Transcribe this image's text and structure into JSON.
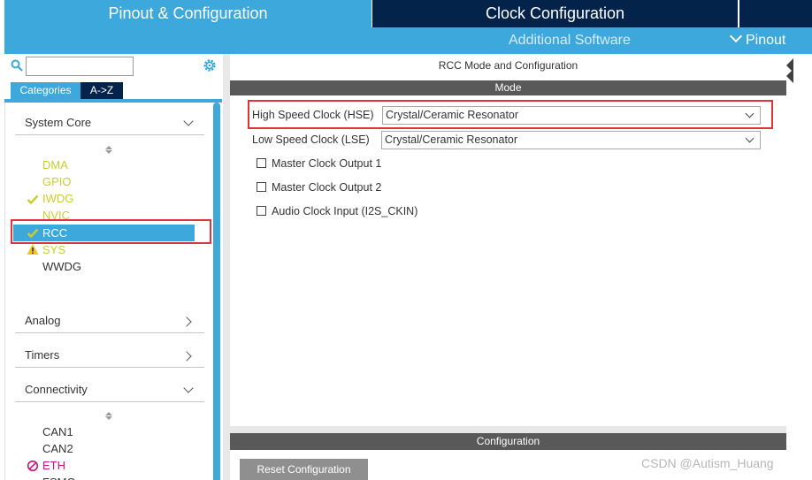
{
  "header": {
    "tabs": [
      "Pinout & Configuration",
      "Clock Configuration"
    ],
    "additional_software": "Additional Software",
    "pinout_menu": "Pinout"
  },
  "left": {
    "search": {
      "value": ""
    },
    "tabs": [
      "Categories",
      "A->Z"
    ],
    "categories": {
      "system_core": "System Core",
      "analog": "Analog",
      "timers": "Timers",
      "connectivity": "Connectivity"
    },
    "system_core_items": [
      "DMA",
      "GPIO",
      "IWDG",
      "NVIC",
      "RCC",
      "SYS",
      "WWDG"
    ],
    "connectivity_items": [
      "CAN1",
      "CAN2",
      "ETH",
      "FSMC"
    ]
  },
  "right": {
    "title": "RCC Mode and Configuration",
    "mode_header": "Mode",
    "hse": {
      "label": "High Speed Clock (HSE)",
      "value": "Crystal/Ceramic Resonator"
    },
    "lse": {
      "label": "Low Speed Clock (LSE)",
      "value": "Crystal/Ceramic Resonator"
    },
    "checkboxes": [
      "Master Clock Output 1",
      "Master Clock Output 2",
      "Audio Clock Input (I2S_CKIN)"
    ],
    "config_header": "Configuration",
    "reset_button": "Reset Configuration"
  },
  "watermark": "CSDN @Autism_Huang",
  "colors": {
    "accent": "#3ca8dc",
    "navy": "#03234b",
    "highlight_red": "#e0323c",
    "ok_green": "#c9ce2f",
    "error_pink": "#c9147c"
  },
  "icons": {
    "search": "search-icon",
    "settings": "gear-icon",
    "check": "check-icon",
    "warning": "warning-icon",
    "disabled": "no-entry-icon"
  }
}
